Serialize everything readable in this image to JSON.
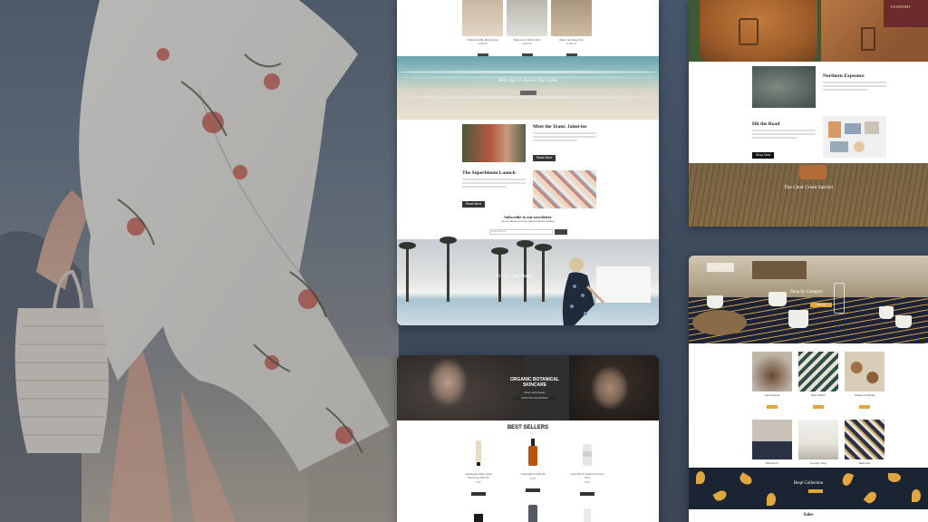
{
  "card_a": {
    "products": [
      {
        "name": "Scarlett Ruffle Maxi Dress",
        "price": "$ 98.00",
        "button": "Add"
      },
      {
        "name": "Bella Linen Wrap Skirt",
        "price": "$ 64.00",
        "button": "Add"
      },
      {
        "name": "Marni Smocked Top",
        "price": "$ 58.00",
        "button": "Add"
      }
    ],
    "welcome_title": "Welcome to Aussie The Label",
    "team_title": "Meet the Team: Jaimi-lee",
    "team_button": "Read More",
    "launch_title": "The Superbloom Launch",
    "launch_button": "Read More",
    "newsletter_title": "Subscribe to our newsletter",
    "newsletter_sub": "Get our latest up for the latest products updates",
    "newsletter_placeholder": "Email address",
    "pool_title": "Fit For The Planet"
  },
  "card_b": {
    "hero_title": "ORGANIC BOTANICAL SKINCARE",
    "hero_sub": "Clean, kind beauty",
    "hero_button": "SHOP THE COLLECTION",
    "best_sellers": "BEST SELLERS",
    "products": [
      {
        "name": "Lightweight Water Glow Sunscreen SPF 30",
        "price": "$ 32",
        "button": "Add To Cart"
      },
      {
        "name": "Antioxidant Facial Oil",
        "price": "$ 48",
        "button": "Add To Cart"
      },
      {
        "name": "Cucumber & Hyaluronic Tonic Mist",
        "price": "$ 28",
        "button": "Add To Cart"
      }
    ]
  },
  "card_c": {
    "passport": "PASSPORT",
    "feature1_title": "Northern Exposure",
    "feature2_title": "Hit the Road",
    "feature2_button": "Shop Now",
    "grass_title": "The Clear Creek Satchel"
  },
  "card_d": {
    "hero_title": "Shop by Category",
    "hero_button": "Shop All",
    "categories": [
      {
        "name": "Home Decor",
        "button": "Shop"
      },
      {
        "name": "Bed & Bath",
        "button": "Shop"
      },
      {
        "name": "Kitchen & Dining",
        "button": "Shop"
      },
      {
        "name": "Wall Decor",
        "button": "Shop"
      },
      {
        "name": "Lounge / Rug",
        "button": "Shop"
      },
      {
        "name": "Bathrobe",
        "button": "Shop"
      }
    ],
    "pattern_title": "Beqé Collection",
    "sales": "Sales"
  },
  "colors": {
    "accent_orange": "#e3a735",
    "dark_button": "#333333",
    "navy": "#1b2433"
  }
}
